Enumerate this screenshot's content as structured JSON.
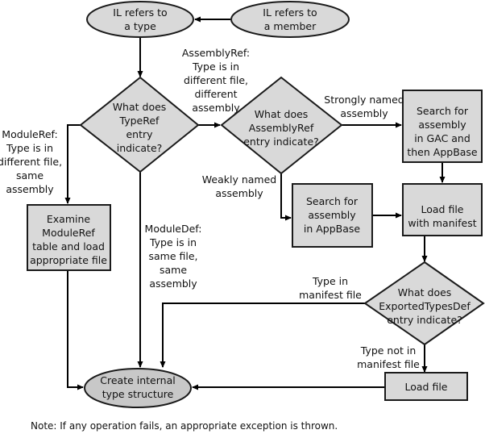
{
  "diagram": {
    "nodes": {
      "il_type": {
        "kind": "start-ellipse",
        "lines": [
          "IL refers to",
          "a type"
        ]
      },
      "il_member": {
        "kind": "start-ellipse",
        "lines": [
          "IL refers to",
          "a member"
        ]
      },
      "typeref_decision": {
        "kind": "decision",
        "lines": [
          "What does",
          "TypeRef",
          "entry",
          "indicate?"
        ]
      },
      "assemblyref_decision": {
        "kind": "decision",
        "lines": [
          "What does",
          "AssemblyRef",
          "entry indicate?"
        ]
      },
      "search_gac": {
        "kind": "process",
        "lines": [
          "Search for",
          "assembly",
          "in GAC and",
          "then AppBase"
        ]
      },
      "search_appbase": {
        "kind": "process",
        "lines": [
          "Search for",
          "assembly",
          "in AppBase"
        ]
      },
      "load_manifest": {
        "kind": "process",
        "lines": [
          "Load file",
          "with manifest"
        ]
      },
      "examine_moduleref": {
        "kind": "process",
        "lines": [
          "Examine",
          "ModuleRef",
          "table and load",
          "appropriate file"
        ]
      },
      "exportedtypes_decision": {
        "kind": "decision",
        "lines": [
          "What does",
          "ExportedTypesDef",
          "entry indicate?"
        ]
      },
      "load_file": {
        "kind": "process",
        "lines": [
          "Load file"
        ]
      },
      "create_type": {
        "kind": "end-ellipse",
        "lines": [
          "Create internal",
          "type structure"
        ]
      }
    },
    "edge_labels": {
      "assemblyref": [
        "AssemblyRef:",
        "Type is in",
        "different file,",
        "different",
        "assembly"
      ],
      "moduleref": [
        "ModuleRef:",
        "Type is in",
        "different file,",
        "same",
        "assembly"
      ],
      "moduledef": [
        "ModuleDef:",
        "Type is in",
        "same file,",
        "same",
        "assembly"
      ],
      "strongly_named": [
        "Strongly named",
        "assembly"
      ],
      "weakly_named": [
        "Weakly named",
        "assembly"
      ],
      "type_in_manifest": [
        "Type in",
        "manifest file"
      ],
      "type_not_in_manifest": [
        "Type not in",
        "manifest file"
      ]
    },
    "edges": [
      {
        "from": "il_member",
        "to": "il_type"
      },
      {
        "from": "il_type",
        "to": "typeref_decision"
      },
      {
        "from": "typeref_decision",
        "to": "assemblyref_decision",
        "label": "assemblyref"
      },
      {
        "from": "typeref_decision",
        "to": "examine_moduleref",
        "label": "moduleref"
      },
      {
        "from": "typeref_decision",
        "to": "create_type",
        "label": "moduledef"
      },
      {
        "from": "assemblyref_decision",
        "to": "search_gac",
        "label": "strongly_named"
      },
      {
        "from": "assemblyref_decision",
        "to": "search_appbase",
        "label": "weakly_named"
      },
      {
        "from": "search_gac",
        "to": "load_manifest"
      },
      {
        "from": "search_appbase",
        "to": "load_manifest"
      },
      {
        "from": "load_manifest",
        "to": "exportedtypes_decision"
      },
      {
        "from": "exportedtypes_decision",
        "to": "create_type",
        "label": "type_in_manifest"
      },
      {
        "from": "exportedtypes_decision",
        "to": "load_file",
        "label": "type_not_in_manifest"
      },
      {
        "from": "load_file",
        "to": "create_type"
      },
      {
        "from": "examine_moduleref",
        "to": "create_type"
      }
    ],
    "note": "Note: If any operation fails, an appropriate exception is thrown."
  },
  "colors": {
    "node_fill": "#d9d9d9",
    "end_node_fill": "#c8c8c8",
    "stroke": "#1a1a1a",
    "background": "#ffffff"
  }
}
